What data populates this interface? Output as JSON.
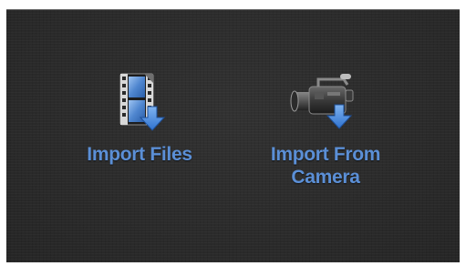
{
  "import_panel": {
    "files_button": {
      "label": "Import Files",
      "icon": "film-import-icon"
    },
    "camera_button": {
      "label_line1": "Import From",
      "label_line2": "Camera",
      "icon": "camera-import-icon"
    }
  },
  "colors": {
    "background": "#2b2b2b",
    "label": "#5b8fd6",
    "arrow": "#3b82d9"
  }
}
